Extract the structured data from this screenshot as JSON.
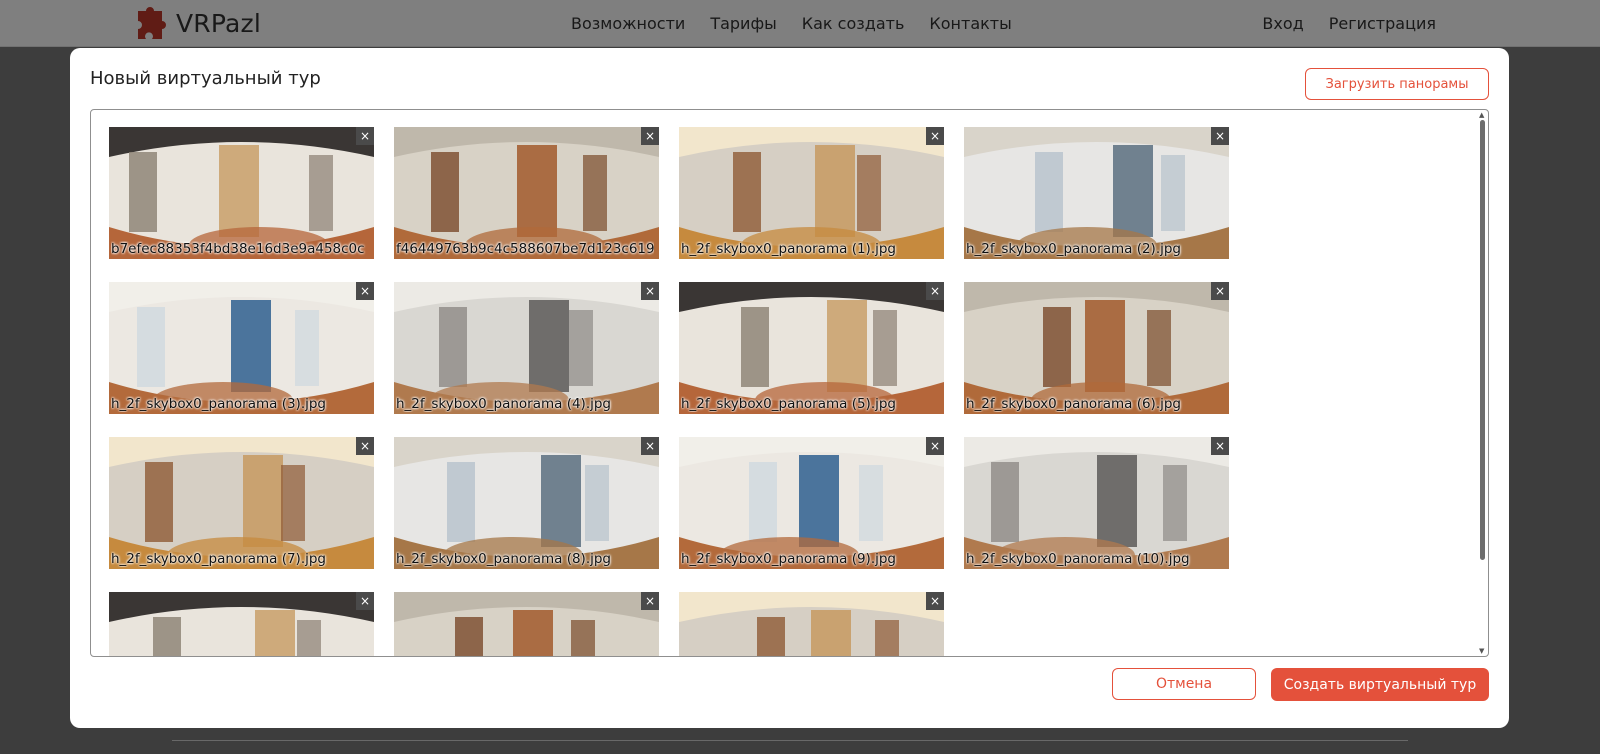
{
  "app": {
    "logo_text": "VRPazl",
    "nav": [
      "Возможности",
      "Тарифы",
      "Как создать",
      "Контакты"
    ],
    "auth": [
      "Вход",
      "Регистрация"
    ],
    "accent_color": "#e4513b"
  },
  "modal": {
    "title": "Новый виртуальный тур",
    "upload_label": "Загрузить панорамы",
    "cancel_label": "Отмена",
    "create_label": "Создать виртуальный тур",
    "delete_glyph": "×",
    "panoramas": [
      "b7efec88353f4bd38e16d3e9a458c0c",
      "f46449763b9c4c588607be7d123c619",
      "h_2f_skybox0_panorama (1).jpg",
      "h_2f_skybox0_panorama (2).jpg",
      "h_2f_skybox0_panorama (3).jpg",
      "h_2f_skybox0_panorama (4).jpg",
      "h_2f_skybox0_panorama (5).jpg",
      "h_2f_skybox0_panorama (6).jpg",
      "h_2f_skybox0_panorama (7).jpg",
      "h_2f_skybox0_panorama (8).jpg",
      "h_2f_skybox0_panorama (9).jpg",
      "h_2f_skybox0_panorama (10).jpg",
      "",
      "",
      ""
    ]
  }
}
